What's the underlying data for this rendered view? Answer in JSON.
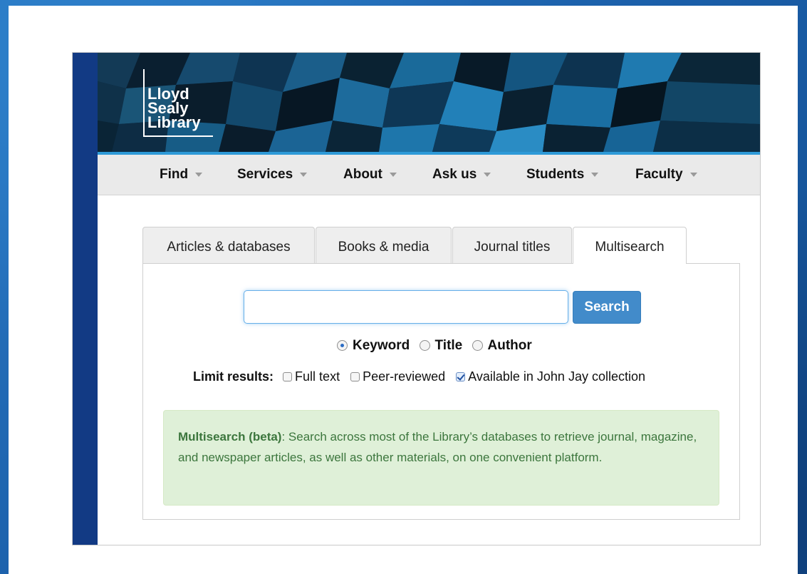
{
  "logo": {
    "text": "Lloyd\nSealy\nLibrary"
  },
  "nav": {
    "items": [
      {
        "label": "Find"
      },
      {
        "label": "Services"
      },
      {
        "label": "About"
      },
      {
        "label": "Ask us"
      },
      {
        "label": "Students"
      },
      {
        "label": "Faculty"
      }
    ]
  },
  "tabs": [
    {
      "label": "Articles & databases",
      "active": false
    },
    {
      "label": "Books & media",
      "active": false
    },
    {
      "label": "Journal titles",
      "active": false
    },
    {
      "label": "Multisearch",
      "active": true
    }
  ],
  "search": {
    "value": "",
    "placeholder": "",
    "button_label": "Search"
  },
  "search_type": {
    "options": [
      {
        "label": "Keyword",
        "checked": true
      },
      {
        "label": "Title",
        "checked": false
      },
      {
        "label": "Author",
        "checked": false
      }
    ]
  },
  "limits": {
    "label": "Limit results:",
    "options": [
      {
        "label": "Full text",
        "checked": false
      },
      {
        "label": "Peer-reviewed",
        "checked": false
      },
      {
        "label": "Available in John Jay collection",
        "checked": true
      }
    ]
  },
  "info": {
    "title": "Multisearch (beta)",
    "text": ": Search across most of the Library’s databases to retrieve journal, magazine, and newspaper articles, as well as other materials, on one convenient platform."
  },
  "colors": {
    "nav_bg": "#eaeaea",
    "accent_line": "#2e9ad8",
    "button": "#428bca",
    "info_bg": "#dff0d8",
    "info_text": "#3c763d",
    "left_bar": "#123a84"
  }
}
